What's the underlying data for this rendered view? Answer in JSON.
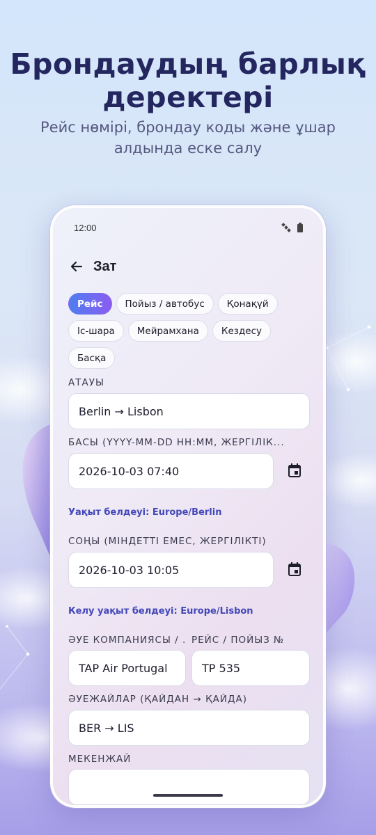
{
  "promo": {
    "headline_line1": "Брондаудың барлық",
    "headline_line2": "деректері",
    "subline_line1": "Рейс нөмірі, брондау коды және ұшар",
    "subline_line2": "алдында еске салу"
  },
  "status_bar": {
    "time": "12:00",
    "icons": [
      "satellite-icon",
      "battery-icon"
    ]
  },
  "appbar": {
    "back_icon": "arrow-left-icon",
    "title": "Зат"
  },
  "categories": {
    "selected": "Рейс",
    "items": [
      "Рейс",
      "Пойыз / автобус",
      "Қонақүй",
      "Іс-шара",
      "Мейрамхана",
      "Кездесу",
      "Басқа"
    ]
  },
  "form": {
    "title": {
      "label": "АТАУЫ",
      "value": "Berlin → Lisbon"
    },
    "start": {
      "label": "БАСЫ (YYYY-MM-DD HH:MM, ЖЕРГІЛІК...",
      "value": "2026-10-03 07:40",
      "timezone_note": "Уақыт белдеуі: Europe/Berlin"
    },
    "end": {
      "label": "СОҢЫ (МІНДЕТТІ ЕМЕС, ЖЕРГІЛІКТІ)",
      "value": "2026-10-03 10:05",
      "timezone_note": "Келу уақыт белдеуі: Europe/Lisbon"
    },
    "airline": {
      "label": "ӘУЕ КОМПАНИЯСЫ / ...",
      "value": "TAP Air Portugal"
    },
    "flight_number": {
      "label": "РЕЙС / ПОЙЫЗ №",
      "value": "TP 535"
    },
    "airports": {
      "label": "ӘУЕЖАЙЛАР (ҚАЙДАН → ҚАЙДА)",
      "value": "BER → LIS"
    },
    "address": {
      "label": "МЕКЕНЖАЙ",
      "value": ""
    }
  },
  "colors": {
    "accent_gradient_start": "#4f7df0",
    "accent_gradient_end": "#8a5cf0",
    "timezone_note": "#4347b8",
    "headline": "#24265f"
  }
}
